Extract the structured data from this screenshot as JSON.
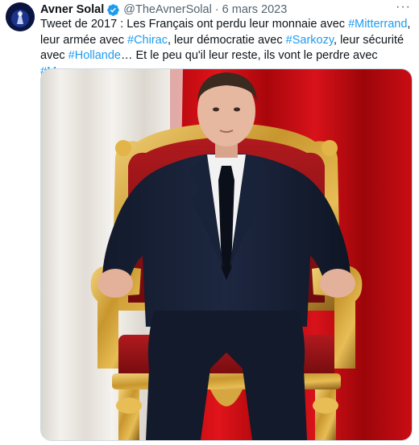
{
  "author": {
    "name": "Avner Solal",
    "handle": "@TheAvnerSolal",
    "separator": "·",
    "date": "6 mars 2023"
  },
  "menu": {
    "more_label": "···"
  },
  "tweet_text": {
    "t1": "Tweet de 2017 : Les Français ont perdu leur monnaie avec ",
    "h1": "#Mitterrand",
    "t2": ", leur armée avec ",
    "h2": "#Chirac",
    "t3": ", leur démocratie avec ",
    "h3": "#Sarkozy",
    "t4": ", leur sécurité avec ",
    "h4": "#Hollande",
    "t5": "… Et le peu qu'il leur reste, ils vont le perdre avec ",
    "h5": "#Macron",
    "t6": "."
  },
  "colors": {
    "hashtag": "#1d9bf0",
    "verified_badge": "#1d9bf0",
    "secondary_text": "#536471"
  },
  "icons": {
    "verified": "verified-badge-icon",
    "more": "more-options-icon"
  }
}
